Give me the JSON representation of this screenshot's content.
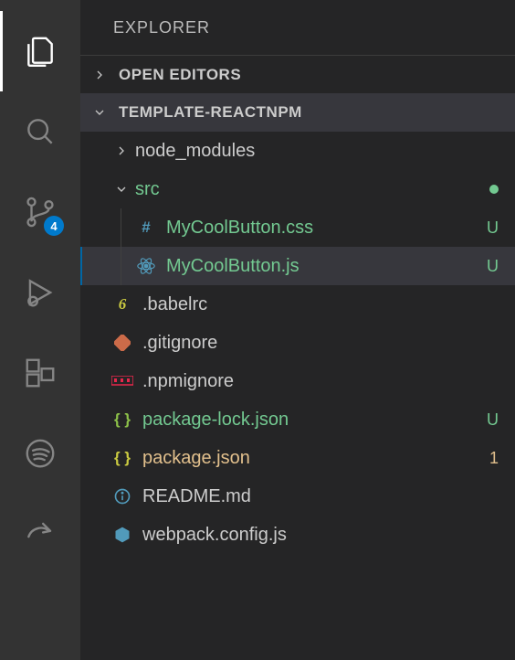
{
  "panel": {
    "title": "EXPLORER"
  },
  "sections": {
    "open_editors": "OPEN EDITORS",
    "project": "TEMPLATE-REACTNPM"
  },
  "scm_badge": "4",
  "tree": {
    "node_modules": "node_modules",
    "src": "src",
    "mycoolbutton_css": "MyCoolButton.css",
    "mycoolbutton_js": "MyCoolButton.js",
    "babelrc": ".babelrc",
    "gitignore": ".gitignore",
    "npmignore": ".npmignore",
    "package_lock": "package-lock.json",
    "package_json": "package.json",
    "readme": "README.md",
    "webpack": "webpack.config.js"
  },
  "status": {
    "untracked": "U",
    "modified_count": "1"
  }
}
